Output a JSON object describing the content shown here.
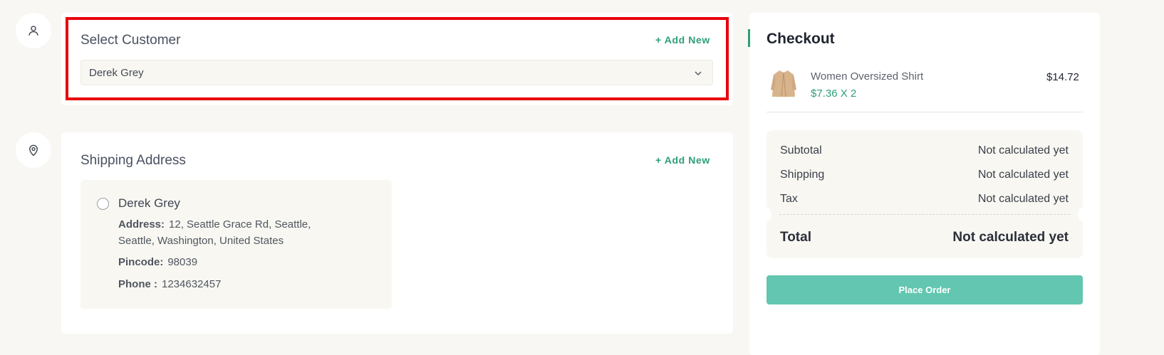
{
  "customer": {
    "title": "Select Customer",
    "add_new": "+ Add New",
    "selected": "Derek Grey"
  },
  "shipping": {
    "title": "Shipping Address",
    "add_new": "+ Add New",
    "address": {
      "name": "Derek Grey",
      "address_label": "Address:",
      "address_line1": "12, Seattle Grace Rd, Seattle,",
      "address_line2": "Seattle, Washington, United States",
      "pincode_label": "Pincode:",
      "pincode": "98039",
      "phone_label": "Phone :",
      "phone": "1234632457"
    }
  },
  "checkout": {
    "title": "Checkout",
    "item": {
      "name": "Women Oversized Shirt",
      "price_qty": "$7.36 X 2",
      "total": "$14.72"
    },
    "summary": {
      "subtotal_label": "Subtotal",
      "subtotal_value": "Not calculated yet",
      "shipping_label": "Shipping",
      "shipping_value": "Not calculated yet",
      "tax_label": "Tax",
      "tax_value": "Not calculated yet",
      "total_label": "Total",
      "total_value": "Not calculated yet"
    },
    "place_order": "Place Order"
  },
  "colors": {
    "accent": "#2e9e78",
    "button": "#62c6b0",
    "highlight": "#e8000b",
    "background": "#f8f7f3"
  },
  "icons": {
    "customer_step": "user-icon",
    "shipping_step": "map-pin-icon",
    "select_chevron": "chevron-down-icon"
  }
}
